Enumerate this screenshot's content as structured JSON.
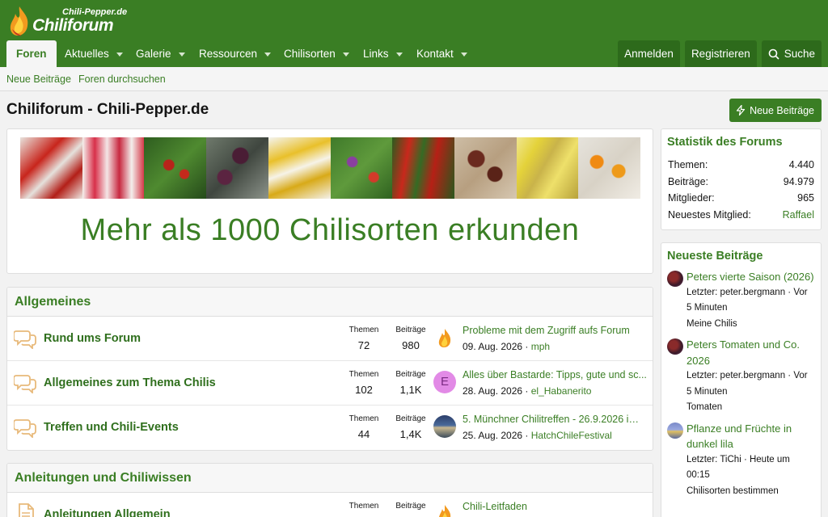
{
  "logo": {
    "small": "Chili-Pepper.de",
    "big": "Chiliforum"
  },
  "nav": {
    "tabs": [
      {
        "label": "Foren"
      },
      {
        "label": "Aktuelles"
      },
      {
        "label": "Galerie"
      },
      {
        "label": "Ressourcen"
      },
      {
        "label": "Chilisorten"
      },
      {
        "label": "Links"
      },
      {
        "label": "Kontakt"
      }
    ],
    "login": "Anmelden",
    "register": "Registrieren",
    "search": "Suche"
  },
  "subnav": {
    "new_posts": "Neue Beiträge",
    "search_forums": "Foren durchsuchen"
  },
  "page": {
    "title": "Chiliforum - Chili-Pepper.de",
    "new_posts_button": "Neue Beiträge"
  },
  "banner": {
    "text": "Mehr als 1000 Chilisorten erkunden"
  },
  "categories": [
    {
      "title": "Allgemeines",
      "nodes": [
        {
          "title": "Rund ums Forum",
          "threads_label": "Themen",
          "threads": "72",
          "posts_label": "Beiträge",
          "posts": "980",
          "last_title": "Probleme mit dem Zugriff aufs Forum",
          "last_date": "09. Aug. 2026",
          "last_user": "mph",
          "avatar_letter": ""
        },
        {
          "title": "Allgemeines zum Thema Chilis",
          "threads_label": "Themen",
          "threads": "102",
          "posts_label": "Beiträge",
          "posts": "1,1K",
          "last_title": "Alles über Bastarde: Tipps, gute und sc...",
          "last_date": "28. Aug. 2026",
          "last_user": "el_Habanerito",
          "avatar_letter": "E"
        },
        {
          "title": "Treffen und Chili-Events",
          "threads_label": "Themen",
          "threads": "44",
          "posts_label": "Beiträge",
          "posts": "1,4K",
          "last_title": "5. Münchner Chilitreffen - 26.9.2026 im ...",
          "last_date": "25. Aug. 2026",
          "last_user": "HatchChileFestival",
          "avatar_letter": ""
        }
      ]
    },
    {
      "title": "Anleitungen und Chiliwissen",
      "nodes": [
        {
          "title": "Anleitungen Allgemein",
          "threads_label": "Themen",
          "threads": "",
          "posts_label": "Beiträge",
          "posts": "",
          "last_title": "Chili-Leitfaden",
          "last_date": "",
          "last_user": "",
          "avatar_letter": ""
        }
      ]
    }
  ],
  "stats": {
    "title": "Statistik des Forums",
    "rows": [
      {
        "label": "Themen:",
        "value": "4.440"
      },
      {
        "label": "Beiträge:",
        "value": "94.979"
      },
      {
        "label": "Mitglieder:",
        "value": "965"
      },
      {
        "label": "Neuestes Mitglied:",
        "value": "Raffael"
      }
    ]
  },
  "latest": {
    "title": "Neueste Beiträge",
    "posts": [
      {
        "title": "Peters vierte Saison (2026)",
        "meta": "Letzter: peter.bergmann · Vor 5 Minuten",
        "forum": "Meine Chilis"
      },
      {
        "title": "Peters Tomaten und Co. 2026",
        "meta": "Letzter: peter.bergmann · Vor 5 Minuten",
        "forum": "Tomaten"
      },
      {
        "title": "Pflanze und Früchte in dunkel lila",
        "meta": "Letzter: TiChi · Heute um 00:15",
        "forum": "Chilisorten bestimmen"
      }
    ]
  },
  "colors": {
    "brand": "#3a7e24",
    "brand_dark": "#2d6a1b",
    "link": "#3a7e24",
    "avatar_e": "#e28ae6"
  }
}
